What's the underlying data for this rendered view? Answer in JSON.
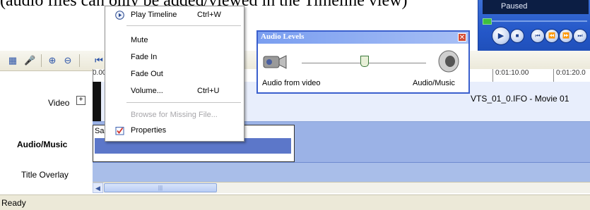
{
  "caption": "(audio files can only be added/viewed in the Timeline view)",
  "monitor": {
    "status": "Paused"
  },
  "ruler": {
    "labels": [
      "0.00",
      "0:01:10.00",
      "0:01:20.0"
    ]
  },
  "tracks": {
    "video": "Video",
    "audio": "Audio/Music",
    "title": "Title Overlay"
  },
  "clips": {
    "video_label": "VTS_01_0.IFO - Movie 01",
    "audio_name": "Sai"
  },
  "context_menu": {
    "items": [
      {
        "label": "Play Timeline",
        "shortcut": "Ctrl+W"
      },
      {
        "label": "Mute",
        "shortcut": ""
      },
      {
        "label": "Fade In",
        "shortcut": ""
      },
      {
        "label": "Fade Out",
        "shortcut": ""
      },
      {
        "label": "Volume...",
        "shortcut": "Ctrl+U"
      },
      {
        "label": "Browse for Missing File...",
        "shortcut": ""
      },
      {
        "label": "Properties",
        "shortcut": ""
      }
    ]
  },
  "audio_levels": {
    "title": "Audio Levels",
    "left_label": "Audio from video",
    "right_label": "Audio/Music",
    "balance": 0.5
  },
  "statusbar": {
    "text": "Ready"
  },
  "colors": {
    "dialog_border": "#3a5fcd",
    "audio_track": "#9bb2e6",
    "status_bg": "#ece9d8"
  }
}
